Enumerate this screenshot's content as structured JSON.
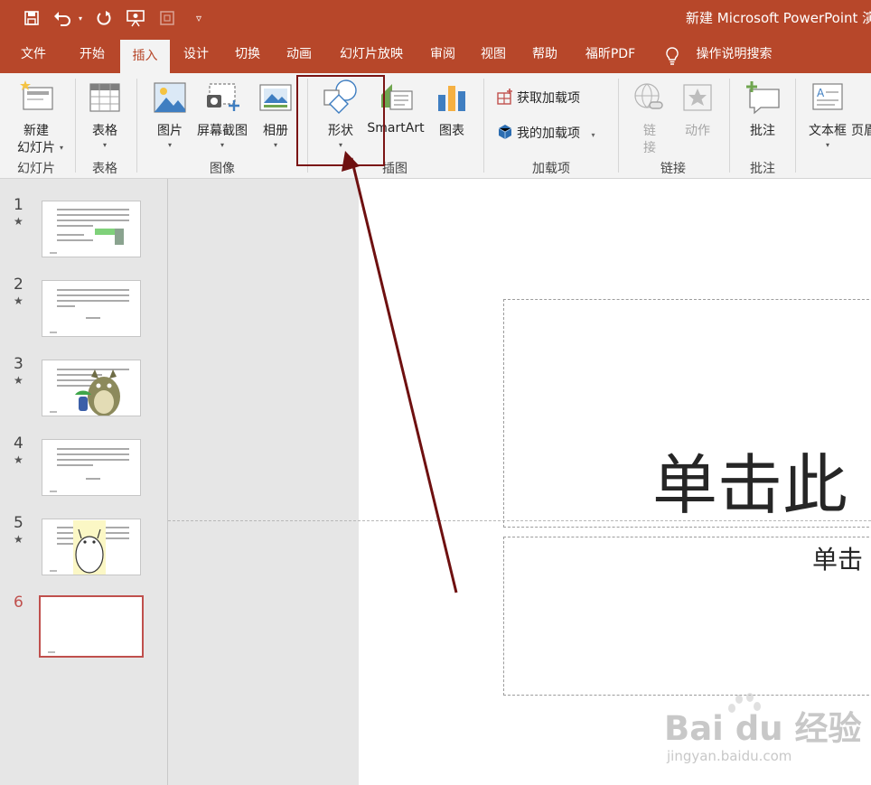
{
  "window": {
    "title": "新建 Microsoft PowerPoint 演"
  },
  "quick_access": [
    "save-icon",
    "undo-icon",
    "redo-icon",
    "present-icon",
    "touch-mode-icon",
    "customize-qat-icon"
  ],
  "tabs": [
    {
      "label": "文件",
      "active": false
    },
    {
      "label": "开始",
      "active": false
    },
    {
      "label": "插入",
      "active": true
    },
    {
      "label": "设计",
      "active": false
    },
    {
      "label": "切换",
      "active": false
    },
    {
      "label": "动画",
      "active": false
    },
    {
      "label": "幻灯片放映",
      "active": false
    },
    {
      "label": "审阅",
      "active": false
    },
    {
      "label": "视图",
      "active": false
    },
    {
      "label": "帮助",
      "active": false
    },
    {
      "label": "福昕PDF",
      "active": false
    }
  ],
  "tell_me": "操作说明搜索",
  "ribbon": {
    "new_slide": {
      "line1": "新建",
      "line2": "幻灯片"
    },
    "table": "表格",
    "picture": "图片",
    "screenshot": "屏幕截图",
    "album": "相册",
    "shapes": "形状",
    "smartart": "SmartArt",
    "chart": "图表",
    "get_addins": "获取加载项",
    "my_addins": "我的加载项",
    "link": {
      "line1": "链",
      "line2": "接"
    },
    "action": "动作",
    "comment": "批注",
    "textbox": "文本框",
    "header_partial": "页眉",
    "groups": {
      "slides": "幻灯片",
      "tables": "表格",
      "images": "图像",
      "illustrations": "插图",
      "addins": "加载项",
      "links": "链接",
      "comments": "批注"
    }
  },
  "thumbnails": [
    {
      "number": "1",
      "star": "★",
      "selected": false
    },
    {
      "number": "2",
      "star": "★",
      "selected": false
    },
    {
      "number": "3",
      "star": "★",
      "selected": false
    },
    {
      "number": "4",
      "star": "★",
      "selected": false
    },
    {
      "number": "5",
      "star": "★",
      "selected": false
    },
    {
      "number": "6",
      "star": "",
      "selected": true
    }
  ],
  "slide": {
    "title_placeholder": "单击此",
    "subtitle_placeholder": "单击"
  },
  "watermark": {
    "brand": "Bai du 经验",
    "url": "jingyan.baidu.com"
  },
  "colors": {
    "accent": "#b7472a",
    "annotation": "#7a1414",
    "selected_thumb": "#c0504d"
  }
}
